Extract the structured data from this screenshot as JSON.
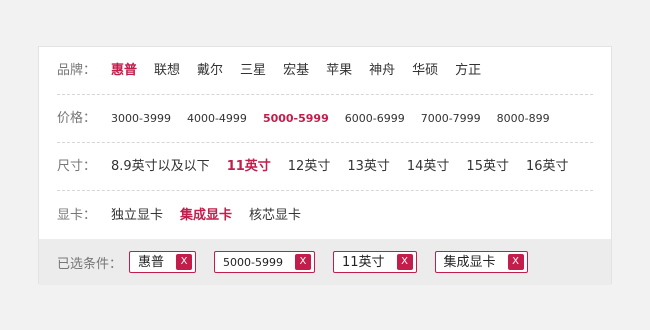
{
  "brand": {
    "label": "品牌：",
    "options": [
      "惠普",
      "联想",
      "戴尔",
      "三星",
      "宏基",
      "苹果",
      "神舟",
      "华硕",
      "方正"
    ],
    "active": "惠普"
  },
  "price": {
    "label": "价格：",
    "options": [
      "3000-3999",
      "4000-4999",
      "5000-5999",
      "6000-6999",
      "7000-7999",
      "8000-899"
    ],
    "active": "5000-5999"
  },
  "size": {
    "label": "尺寸：",
    "options": [
      "8.9英寸以及以下",
      "11英寸",
      "12英寸",
      "13英寸",
      "14英寸",
      "15英寸",
      "16英寸"
    ],
    "active": "11英寸"
  },
  "gpu": {
    "label": "显卡：",
    "options": [
      "独立显卡",
      "集成显卡",
      "核芯显卡"
    ],
    "active": "集成显卡"
  },
  "selected": {
    "label": "已选条件：",
    "tags": [
      {
        "text": "惠普",
        "close": "X"
      },
      {
        "text": "5000-5999",
        "close": "X"
      },
      {
        "text": "11英寸",
        "close": "X"
      },
      {
        "text": "集成显卡",
        "close": "X"
      }
    ]
  },
  "colors": {
    "accent": "#c21d4b",
    "background": "#f2f2f2",
    "selected_bar": "#ececec"
  }
}
